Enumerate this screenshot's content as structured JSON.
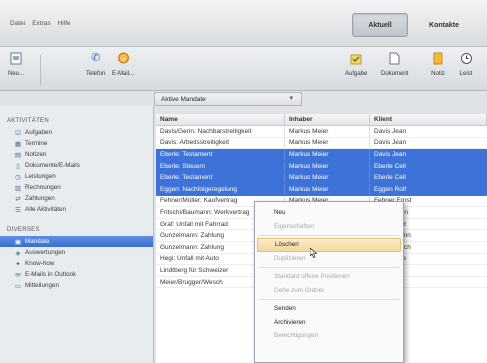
{
  "menu": [
    "Datei",
    "Extras",
    "Hilfe"
  ],
  "topnav": {
    "aktuell": "Aktuell",
    "kontakte": "Kontakte"
  },
  "toolbar": {
    "neu": "Neu...",
    "telefon": "Telefon",
    "email": "E-Mail...",
    "aufgabe": "Aufgabe",
    "dokument": "Dokument",
    "notiz": "Notiz",
    "last": "Leist"
  },
  "filter": {
    "value": "Aktive Mandate"
  },
  "sidebar": {
    "aktivitaeten_title": "AKTIVITÄTEN",
    "aktivitaeten": [
      "Aufgaben",
      "Termine",
      "Notizen",
      "Dokumente/E-Mails",
      "Leistungen",
      "Rechnungen",
      "Zahlungen",
      "Alle Aktivitäten"
    ],
    "diverses_title": "DIVERSES",
    "diverses": [
      "Mandate",
      "Auswertungen",
      "Know-how",
      "E-Mails in Outlook",
      "Mitteilungen"
    ]
  },
  "table": {
    "headers": [
      "Name",
      "Inhaber",
      "Klient"
    ],
    "rows": [
      {
        "name": "Davis/Gerin: Nachbarstreitigkeit",
        "inhaber": "Markus Meier",
        "klient": "Davis Jean",
        "selected": false
      },
      {
        "name": "Davis: Arbeitsstreitigkeit",
        "inhaber": "Markus Meier",
        "klient": "Davis Jean",
        "selected": false
      },
      {
        "name": "Eberle: Testament",
        "inhaber": "Markus Meier",
        "klient": "Davis Jean",
        "selected": true
      },
      {
        "name": "Eberle: Steuern",
        "inhaber": "Markus Meier",
        "klient": "Eberle Cell",
        "selected": true
      },
      {
        "name": "Eberle: Testament",
        "inhaber": "Markus Meier",
        "klient": "Eberle Cell",
        "selected": true
      },
      {
        "name": "Eggen: Nachfolgeregelung",
        "inhaber": "Markus Meier",
        "klient": "Eggen Rolf",
        "selected": true
      },
      {
        "name": "Fehner/Müller: Kaufvertrag",
        "inhaber": "Markus Meier",
        "klient": "Fehner Ernst",
        "selected": false
      },
      {
        "name": "Fritschi/Baumann: Werkvertrag",
        "inhaber": "Markus Meier",
        "klient": "Fritschi Ann",
        "selected": false
      },
      {
        "name": "Graf: Unfall mit Fahrrad",
        "inhaber": "Markus Meier",
        "klient": "Graf Moritz",
        "selected": false
      },
      {
        "name": "Gunzelmann: Zahlung",
        "inhaber": "Markus Meier",
        "klient": "Gunzelmann",
        "selected": false
      },
      {
        "name": "Gunzelmann: Zahlung",
        "inhaber": "Markus Meier",
        "klient": "Abt Friedrich",
        "selected": false
      },
      {
        "name": "Hegi: Unfall mit Auto",
        "inhaber": "Markus Meier",
        "klient": "Hegi Andre",
        "selected": false
      },
      {
        "name": "Lindtberg für Schweizer",
        "inhaber": "Markus Meier",
        "klient": "Schweizer",
        "selected": false
      },
      {
        "name": "Meier/Brugger/Wesch",
        "inhaber": "Markus Meier",
        "klient": "Brugger M",
        "selected": false
      }
    ]
  },
  "context_menu": {
    "items": [
      {
        "label": "Neu",
        "disabled": false,
        "highlight": false
      },
      {
        "label": "Eigenschaften",
        "disabled": true,
        "highlight": false
      },
      {
        "sep": true
      },
      {
        "label": "Löschen",
        "disabled": false,
        "highlight": true
      },
      {
        "label": "Duplizieren",
        "disabled": true,
        "highlight": false
      },
      {
        "sep": true
      },
      {
        "label": "Standard offene Positionen",
        "disabled": true,
        "highlight": false
      },
      {
        "label": "Gehe zum Ordner",
        "disabled": true,
        "highlight": false
      },
      {
        "sep": true
      },
      {
        "label": "Senden",
        "disabled": false,
        "highlight": false
      },
      {
        "label": "Archivieren",
        "disabled": false,
        "highlight": false
      },
      {
        "label": "Berechtigungen",
        "disabled": true,
        "highlight": false
      }
    ]
  },
  "colors": {
    "selection": "#3d73d8",
    "menu_highlight": "#f4d79a"
  }
}
